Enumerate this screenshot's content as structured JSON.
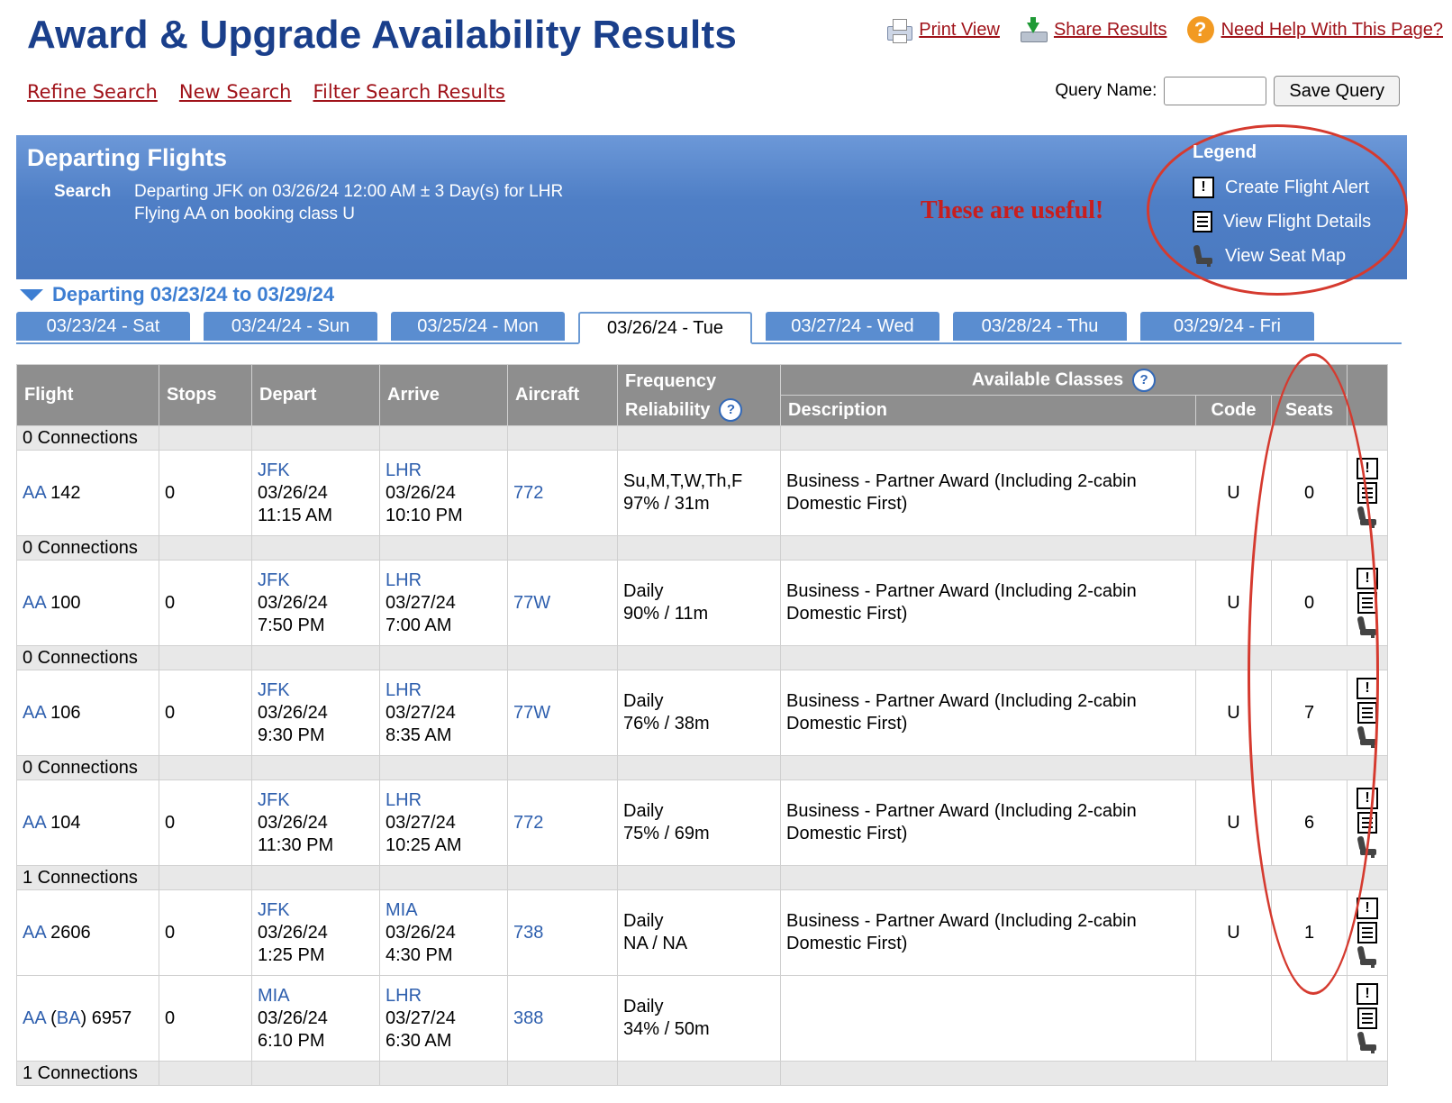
{
  "header": {
    "title": "Award & Upgrade Availability Results",
    "print_view": "Print View",
    "share_results": "Share Results",
    "help": "Need Help With This Page?"
  },
  "actions": {
    "refine": "Refine Search",
    "new": "New Search",
    "filter": "Filter Search Results"
  },
  "query": {
    "label": "Query Name:",
    "value": "",
    "save": "Save Query"
  },
  "banner": {
    "title": "Departing Flights",
    "search_label": "Search",
    "search_line1": "Departing JFK on 03/26/24 12:00 AM ± 3 Day(s) for LHR",
    "search_line2": "Flying AA on booking class U",
    "annotation": "These are useful!",
    "legend_title": "Legend",
    "legend_items": [
      "Create Flight Alert",
      "View Flight Details",
      "View Seat Map"
    ]
  },
  "range": "Departing 03/23/24 to 03/29/24",
  "tabs": [
    "03/23/24 - Sat",
    "03/24/24 - Sun",
    "03/25/24 - Mon",
    "03/26/24 - Tue",
    "03/27/24 - Wed",
    "03/28/24 - Thu",
    "03/29/24 - Fri"
  ],
  "active_tab": 3,
  "table": {
    "headers": {
      "flight": "Flight",
      "stops": "Stops",
      "depart": "Depart",
      "arrive": "Arrive",
      "aircraft": "Aircraft",
      "freq1": "Frequency",
      "freq2": "Reliability",
      "avail": "Available Classes",
      "desc": "Description",
      "code": "Code",
      "seats": "Seats"
    },
    "groups": [
      {
        "conn": "0 Connections",
        "flights": [
          {
            "carrier": "AA",
            "number": "142",
            "stops": "0",
            "dep_ap": "JFK",
            "dep_date": "03/26/24",
            "dep_time": "11:15 AM",
            "arr_ap": "LHR",
            "arr_date": "03/26/24",
            "arr_time": "10:10 PM",
            "aircraft": "772",
            "freq": "Su,M,T,W,Th,F",
            "rel": "97% / 31m",
            "desc1": "Business - Partner Award (Including 2-cabin",
            "desc2": "Domestic First)",
            "code": "U",
            "seats": "0"
          }
        ]
      },
      {
        "conn": "0 Connections",
        "flights": [
          {
            "carrier": "AA",
            "number": "100",
            "stops": "0",
            "dep_ap": "JFK",
            "dep_date": "03/26/24",
            "dep_time": "7:50 PM",
            "arr_ap": "LHR",
            "arr_date": "03/27/24",
            "arr_time": "7:00 AM",
            "aircraft": "77W",
            "freq": "Daily",
            "rel": "90% / 11m",
            "desc1": "Business - Partner Award (Including 2-cabin",
            "desc2": "Domestic First)",
            "code": "U",
            "seats": "0"
          }
        ]
      },
      {
        "conn": "0 Connections",
        "flights": [
          {
            "carrier": "AA",
            "number": "106",
            "stops": "0",
            "dep_ap": "JFK",
            "dep_date": "03/26/24",
            "dep_time": "9:30 PM",
            "arr_ap": "LHR",
            "arr_date": "03/27/24",
            "arr_time": "8:35 AM",
            "aircraft": "77W",
            "freq": "Daily",
            "rel": "76% / 38m",
            "desc1": "Business - Partner Award (Including 2-cabin",
            "desc2": "Domestic First)",
            "code": "U",
            "seats": "7"
          }
        ]
      },
      {
        "conn": "0 Connections",
        "flights": [
          {
            "carrier": "AA",
            "number": "104",
            "stops": "0",
            "dep_ap": "JFK",
            "dep_date": "03/26/24",
            "dep_time": "11:30 PM",
            "arr_ap": "LHR",
            "arr_date": "03/27/24",
            "arr_time": "10:25 AM",
            "aircraft": "772",
            "freq": "Daily",
            "rel": "75% / 69m",
            "desc1": "Business - Partner Award (Including 2-cabin",
            "desc2": "Domestic First)",
            "code": "U",
            "seats": "6"
          }
        ]
      },
      {
        "conn": "1 Connections",
        "flights": [
          {
            "carrier": "AA",
            "number": "2606",
            "stops": "0",
            "dep_ap": "JFK",
            "dep_date": "03/26/24",
            "dep_time": "1:25 PM",
            "arr_ap": "MIA",
            "arr_date": "03/26/24",
            "arr_time": "4:30 PM",
            "aircraft": "738",
            "freq": "Daily",
            "rel": "NA / NA",
            "desc1": "Business - Partner Award (Including 2-cabin",
            "desc2": "Domestic First)",
            "code": "U",
            "seats": "1"
          },
          {
            "carrier": "AA",
            "partner": "BA",
            "number": "6957",
            "stops": "0",
            "dep_ap": "MIA",
            "dep_date": "03/26/24",
            "dep_time": "6:10 PM",
            "arr_ap": "LHR",
            "arr_date": "03/27/24",
            "arr_time": "6:30 AM",
            "aircraft": "388",
            "freq": "Daily",
            "rel": "34% / 50m",
            "desc1": "",
            "desc2": "",
            "code": "",
            "seats": ""
          }
        ]
      },
      {
        "conn": "1 Connections",
        "flights": []
      }
    ]
  }
}
